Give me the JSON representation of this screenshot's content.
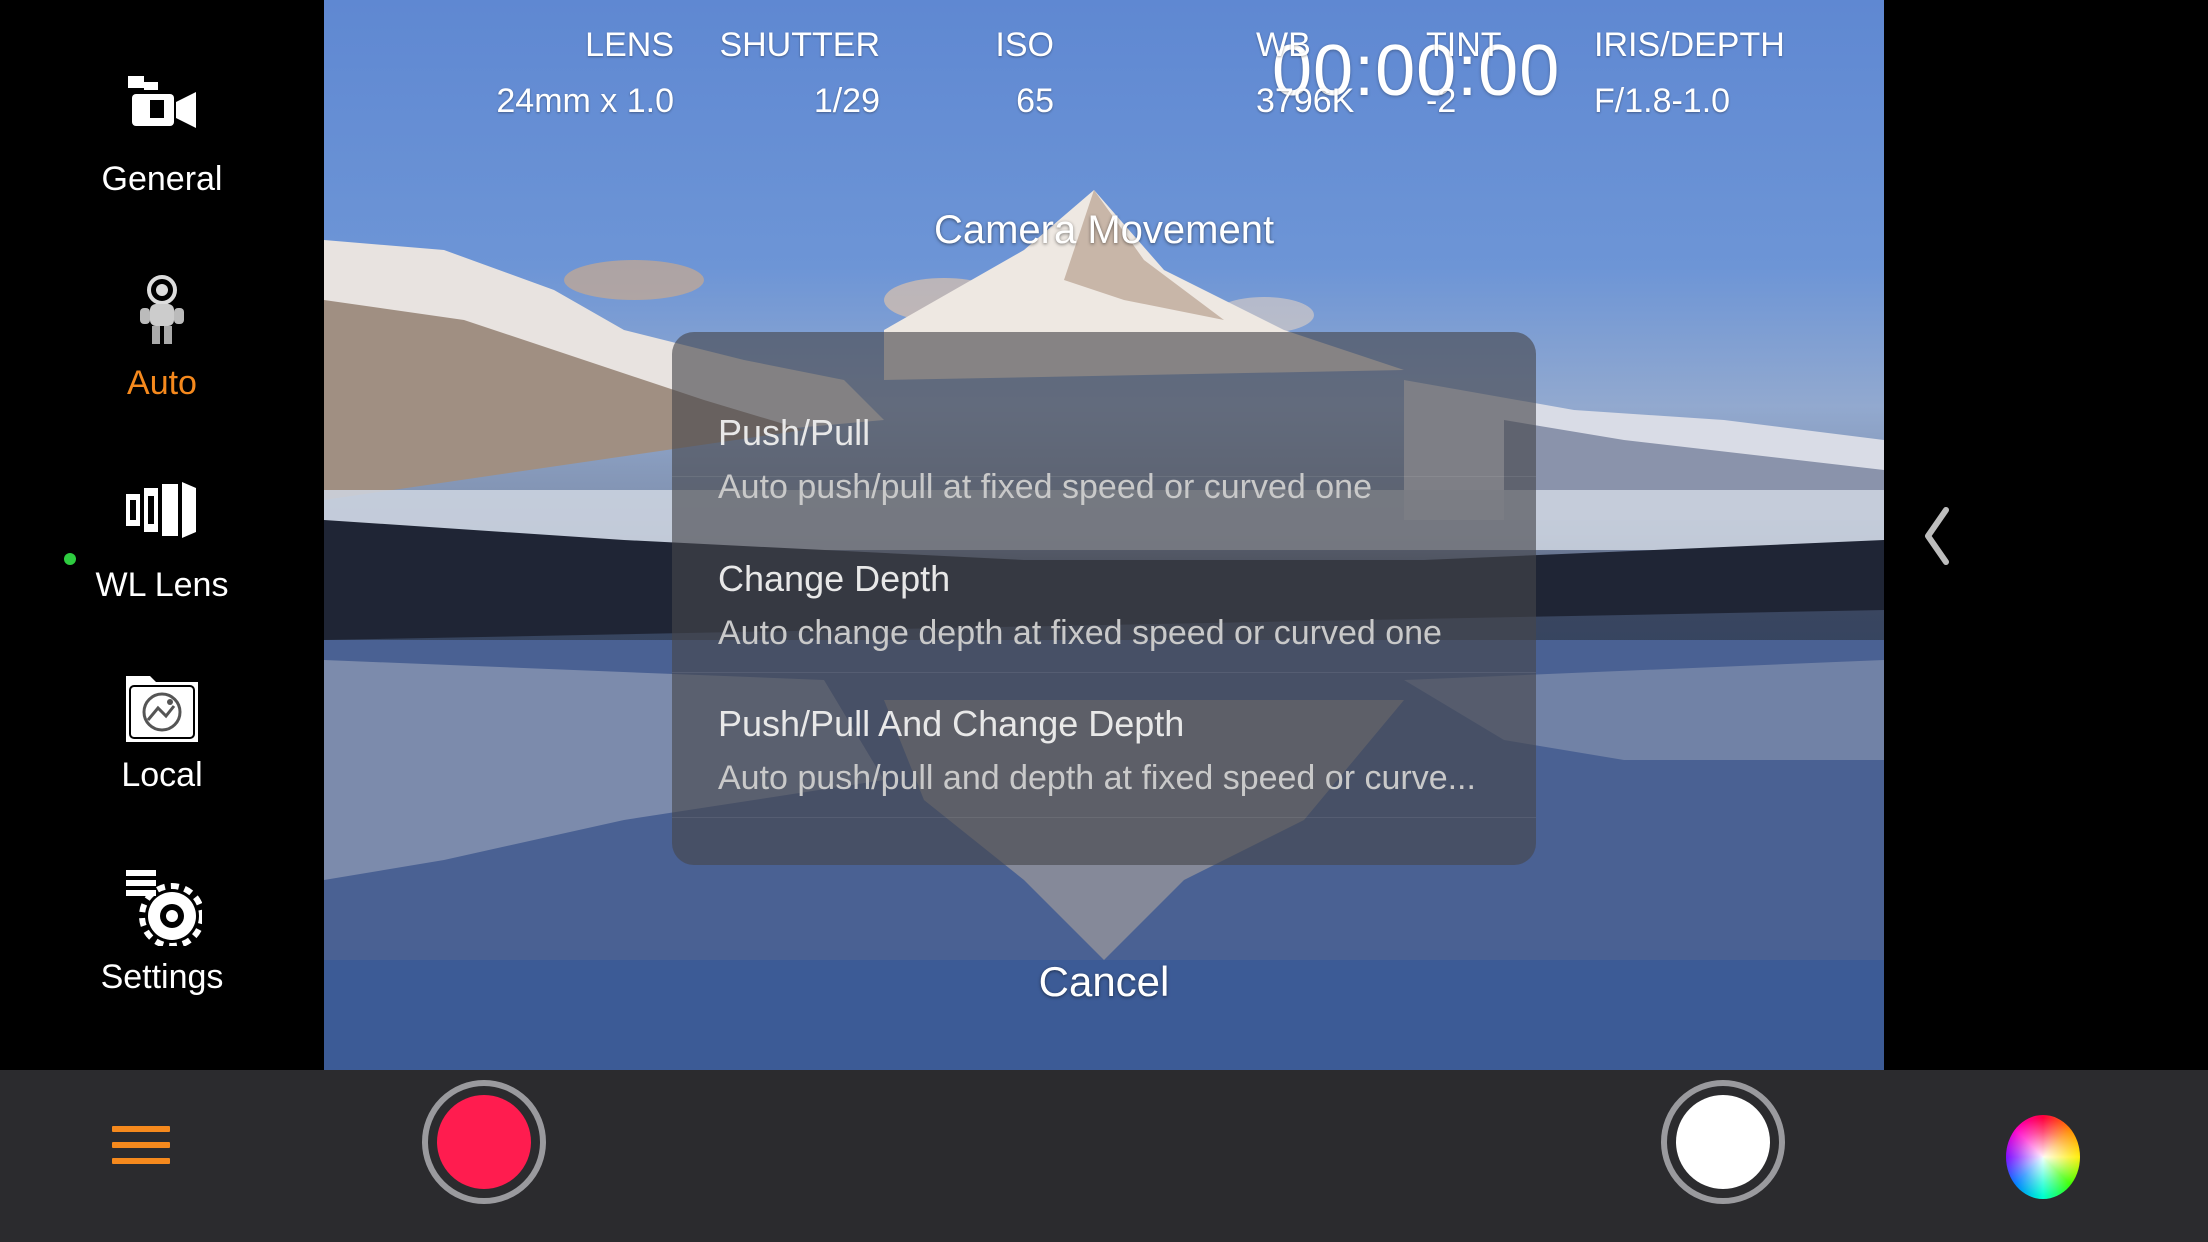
{
  "sidebar": {
    "items": [
      {
        "label": "General",
        "icon": "video-camera-icon"
      },
      {
        "label": "Auto",
        "icon": "astronaut-icon",
        "active": true
      },
      {
        "label": "WL Lens",
        "icon": "lens-icon"
      },
      {
        "label": "Local",
        "icon": "folder-image-icon"
      },
      {
        "label": "Settings",
        "icon": "settings-gear-icon"
      }
    ]
  },
  "hud": {
    "lens": {
      "label": "LENS",
      "value": "24mm x 1.0"
    },
    "shutter": {
      "label": "SHUTTER",
      "value": "1/29"
    },
    "iso": {
      "label": "ISO",
      "value": "65"
    },
    "timecode": "00:00:00",
    "wb": {
      "label": "WB",
      "value": "3796K"
    },
    "tint": {
      "label": "TINT",
      "value": "-2"
    },
    "iris": {
      "label": "IRIS/DEPTH",
      "value": "F/1.8-1.0"
    }
  },
  "sheet": {
    "title": "Camera Movement",
    "options": [
      {
        "title": "Push/Pull",
        "desc": "Auto push/pull at fixed speed or curved one"
      },
      {
        "title": "Change Depth",
        "desc": "Auto change depth at fixed speed or curved one"
      },
      {
        "title": "Push/Pull And Change Depth",
        "desc": "Auto push/pull and depth at fixed speed or curve..."
      }
    ],
    "cancel": "Cancel"
  },
  "colors": {
    "accent": "#f5891d",
    "record": "#ff1c4f",
    "toolbar": "#2b2b2e",
    "status_dot": "#2ecc40"
  }
}
